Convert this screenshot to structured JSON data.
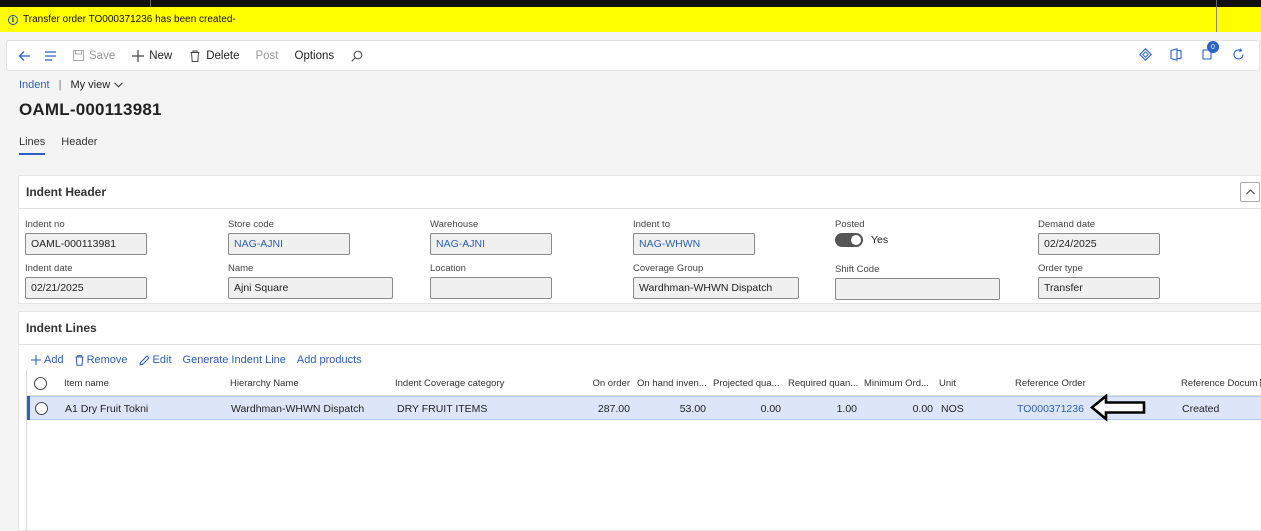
{
  "message": {
    "text": "Transfer order TO000371236 has been created-",
    "icon": "info-icon"
  },
  "toolbar": {
    "save": "Save",
    "new": "New",
    "delete": "Delete",
    "post": "Post",
    "options": "Options",
    "notification_count": "0"
  },
  "breadcrumb": {
    "root": "Indent",
    "view": "My view"
  },
  "page_title": "OAML-000113981",
  "tabs": [
    {
      "label": "Lines"
    },
    {
      "label": "Header"
    }
  ],
  "header_panel": {
    "title": "Indent Header",
    "fields": {
      "indent_no": {
        "label": "Indent no",
        "value": "OAML-000113981"
      },
      "store_code": {
        "label": "Store code",
        "value": "NAG-AJNI"
      },
      "warehouse": {
        "label": "Warehouse",
        "value": "NAG-AJNI"
      },
      "indent_to": {
        "label": "Indent to",
        "value": "NAG-WHWN"
      },
      "posted": {
        "label": "Posted",
        "value": "Yes"
      },
      "demand_date": {
        "label": "Demand date",
        "value": "02/24/2025"
      },
      "indent_date": {
        "label": "Indent date",
        "value": "02/21/2025"
      },
      "name": {
        "label": "Name",
        "value": "Ajni Square"
      },
      "location": {
        "label": "Location",
        "value": ""
      },
      "coverage_group": {
        "label": "Coverage Group",
        "value": "Wardhman-WHWN Dispatch"
      },
      "shift_code": {
        "label": "Shift Code",
        "value": ""
      },
      "order_type": {
        "label": "Order type",
        "value": "Transfer"
      }
    }
  },
  "lines_panel": {
    "title": "Indent Lines",
    "actions": {
      "add": "Add",
      "remove": "Remove",
      "edit": "Edit",
      "generate": "Generate Indent Line",
      "add_products": "Add products"
    },
    "columns": {
      "item_name": "Item name",
      "hierarchy": "Hierarchy Name",
      "coverage_category": "Indent Coverage category",
      "on_order": "On order",
      "on_hand": "On hand inven...",
      "projected": "Projected qua...",
      "required": "Required quan...",
      "minimum": "Minimum Ord...",
      "unit": "Unit",
      "reference_order": "Reference Order",
      "reference_doc": "Reference Docum"
    },
    "rows": [
      {
        "item_name": "A1 Dry Fruit Tokni",
        "hierarchy": "Wardhman-WHWN Dispatch",
        "coverage_category": "DRY FRUIT ITEMS",
        "on_order": "287.00",
        "on_hand": "53.00",
        "projected": "0.00",
        "required": "1.00",
        "minimum": "0.00",
        "unit": "NOS",
        "reference_order": "TO000371236",
        "reference_doc": "Created"
      }
    ]
  },
  "colors": {
    "accent": "#2a62c9",
    "link": "#2d5fb5",
    "message_bg": "#ffff00"
  }
}
